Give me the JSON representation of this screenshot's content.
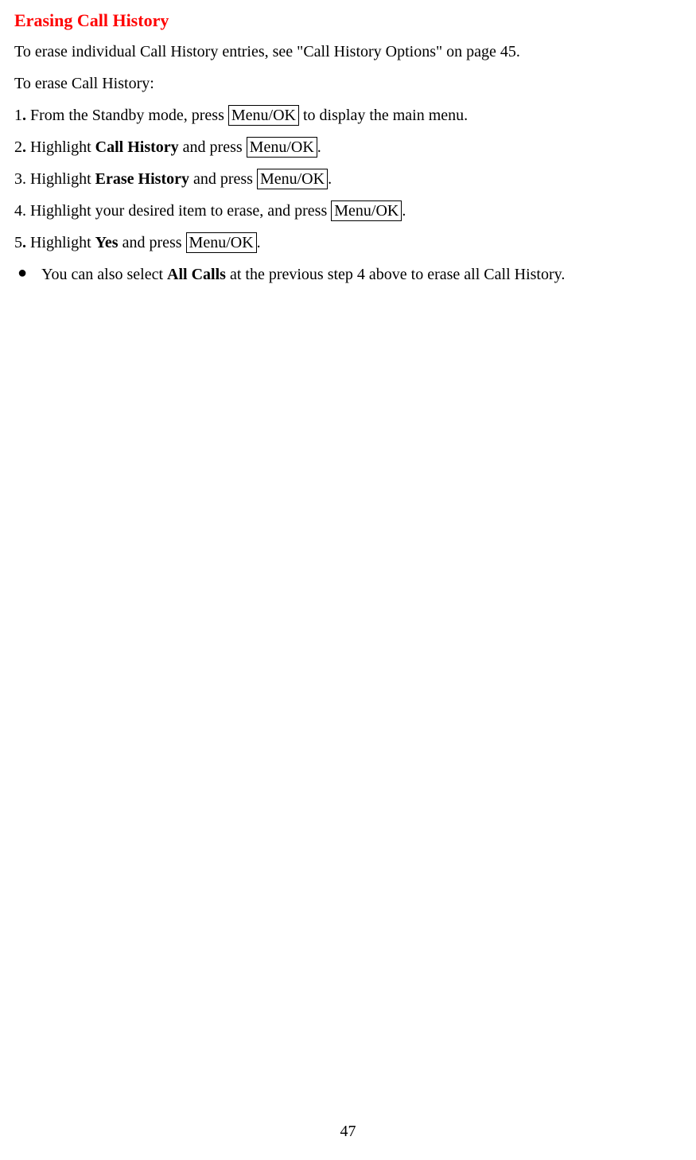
{
  "heading": "Erasing Call History",
  "intro": {
    "pre": "To erase individual Call History entries, see \"Call History Options\" on page 45."
  },
  "lead": "To erase Call History:",
  "steps": {
    "s1": {
      "num": "1",
      "pre": " From the Standby mode, press ",
      "btn": "Menu/OK",
      "post": " to display the main menu."
    },
    "s2": {
      "num": "2",
      "pre": " Highlight ",
      "bold": "Call History",
      "mid": " and press ",
      "btn": "Menu/OK",
      "post": "."
    },
    "s3": {
      "num": "3",
      "pre": ". Highlight ",
      "bold": "Erase History",
      "mid": " and press ",
      "btn": "Menu/OK",
      "post": "."
    },
    "s4": {
      "num": "4",
      "pre": ". Highlight your desired item to erase, and press ",
      "btn": "Menu/OK",
      "post": "."
    },
    "s5": {
      "num": "5",
      "pre": " Highlight ",
      "bold": "Yes",
      "mid": " and press ",
      "btn": "Menu/OK",
      "post": "."
    }
  },
  "bullet": {
    "pre": "You can also select ",
    "bold": "All Calls",
    "post": " at the previous step 4 above to erase all Call History."
  },
  "page_number": "47"
}
